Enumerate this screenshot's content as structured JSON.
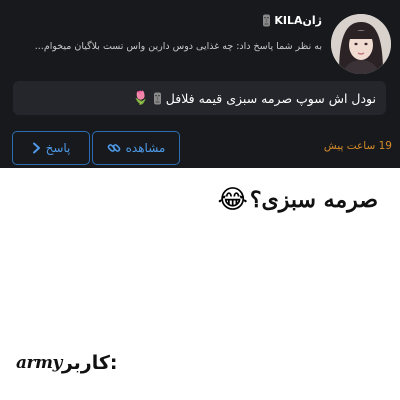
{
  "notification": {
    "username": "KILAژان",
    "message": "به نظر شما پاسخ داد: چه غذایی دوس دارین واس تست بلاگیان میخوام...",
    "quote": "نودل اش سوپ صرمه سبزی قیمه فلافل",
    "time": "19 ساعت پیش"
  },
  "buttons": {
    "reply_label": "پاسخ",
    "view_label": "مشاهده"
  },
  "icons": {
    "idol": "moai-icon",
    "quote_emoji": "tulip-icon",
    "reply": "chevron-right-icon",
    "view": "link-icon",
    "caption_emoji": "tears-of-joy-icon"
  },
  "colors": {
    "panel_bg": "#17191d",
    "quote_bg": "#24262b",
    "button_border": "#2c6db3",
    "button_text": "#4e9ae8",
    "time_text": "#d38a2a"
  },
  "caption": {
    "text": "صرمه سبزی؟"
  },
  "signature": {
    "user_label": "کاربر:",
    "army": "army"
  }
}
